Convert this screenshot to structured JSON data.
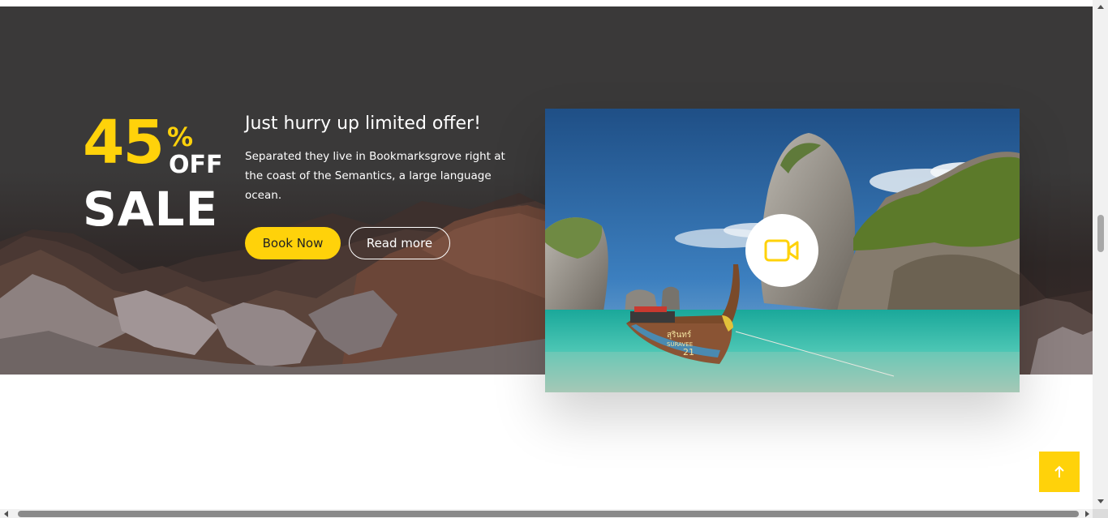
{
  "promo": {
    "sale_number": "45",
    "sale_percent": "%",
    "sale_off": "OFF",
    "sale_word": "SALE",
    "title": "Just hurry up limited offer!",
    "description": "Separated they live in Bookmarksgrove right at the coast of the Semantics, a large language ocean.",
    "book_button": "Book Now",
    "read_button": "Read more"
  },
  "video": {
    "icon": "video-camera-icon",
    "boat_text_line1": "สุรินทร์",
    "boat_text_line2": "SURAVEE",
    "boat_number": "21"
  },
  "back_to_top": {
    "icon": "arrow-up-icon"
  },
  "colors": {
    "accent": "#ffd20a",
    "dark_band": "#3a3939",
    "white": "#ffffff"
  }
}
